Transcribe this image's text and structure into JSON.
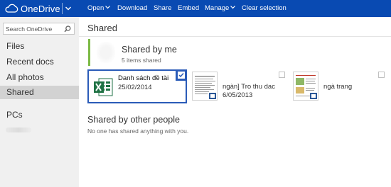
{
  "app": {
    "name": "OneDrive"
  },
  "toolbar": {
    "open": "Open",
    "download": "Download",
    "share": "Share",
    "embed": "Embed",
    "manage": "Manage",
    "clear_selection": "Clear selection"
  },
  "search": {
    "placeholder": "Search OneDrive"
  },
  "sidebar": {
    "items": [
      {
        "label": "Files"
      },
      {
        "label": "Recent docs"
      },
      {
        "label": "All photos"
      },
      {
        "label": "Shared",
        "active": true
      },
      {
        "label": "PCs"
      }
    ]
  },
  "main": {
    "title": "Shared",
    "shared_by_me": {
      "title": "Shared by me",
      "count": "5 items shared",
      "files": [
        {
          "name": "Danh sách đề tài",
          "date": "25/02/2014",
          "icon": "excel-icon",
          "selected": true
        },
        {
          "name": "ngàn] Tro thu dac",
          "date": "6/05/2013",
          "icon": "word-icon",
          "selected": false
        },
        {
          "name": "ngà      trang",
          "date": "",
          "icon": "word-icon",
          "selected": false
        }
      ]
    },
    "shared_by_others": {
      "title": "Shared by other people",
      "message": "No one has shared anything with you."
    }
  },
  "colors": {
    "topbar": "#094ab2",
    "selection": "#2a5bb8",
    "excel_green": "#1f7244",
    "word_blue": "#2b5797"
  }
}
